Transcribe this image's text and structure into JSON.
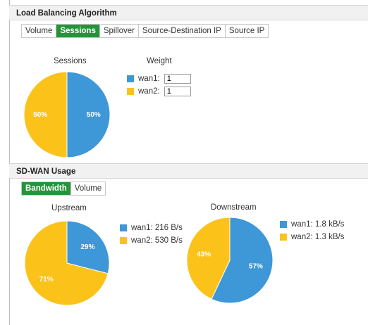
{
  "colors": {
    "wan1": "#3e97d6",
    "wan2": "#fbc31a",
    "active_tab": "#24943b"
  },
  "load_balancing": {
    "title": "Load Balancing Algorithm",
    "tabs": [
      "Volume",
      "Sessions",
      "Spillover",
      "Source-Destination IP",
      "Source IP"
    ],
    "active_tab": "Sessions",
    "sessions_title": "Sessions",
    "weight_title": "Weight",
    "weights": [
      {
        "label": "wan1:",
        "value": "1",
        "icon": "blue-square-icon"
      },
      {
        "label": "wan2:",
        "value": "1",
        "icon": "yellow-square-icon"
      }
    ]
  },
  "sdwan_usage": {
    "title": "SD-WAN Usage",
    "tabs": [
      "Bandwidth",
      "Volume"
    ],
    "active_tab": "Bandwidth",
    "upstream_title": "Upstream",
    "downstream_title": "Downstream",
    "upstream_legend": [
      "wan1: 216 B/s",
      "wan2: 530 B/s"
    ],
    "downstream_legend": [
      "wan1: 1.8 kB/s",
      "wan2: 1.3 kB/s"
    ]
  },
  "chart_data": [
    {
      "type": "pie",
      "title": "Sessions",
      "categories": [
        "wan1",
        "wan2"
      ],
      "values": [
        50,
        50
      ],
      "labels": [
        "50%",
        "50%"
      ]
    },
    {
      "type": "pie",
      "title": "Upstream",
      "categories": [
        "wan1",
        "wan2"
      ],
      "values": [
        29,
        71
      ],
      "labels": [
        "29%",
        "71%"
      ]
    },
    {
      "type": "pie",
      "title": "Downstream",
      "categories": [
        "wan1",
        "wan2"
      ],
      "values": [
        57,
        43
      ],
      "labels": [
        "57%",
        "43%"
      ]
    }
  ]
}
